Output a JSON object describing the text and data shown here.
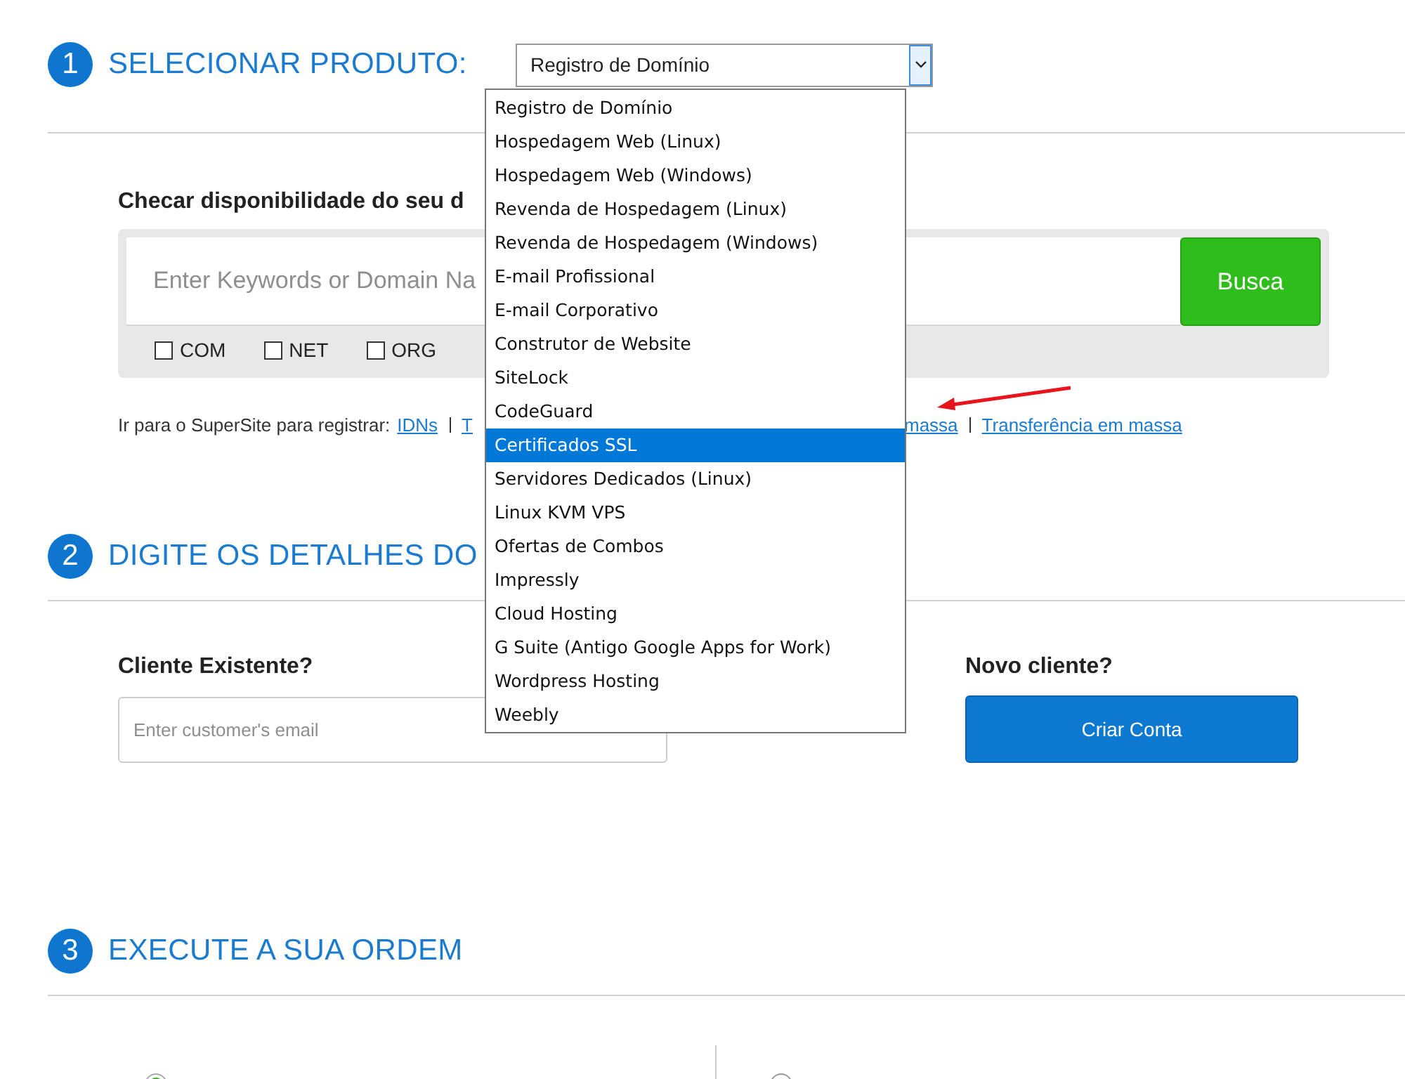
{
  "step1": {
    "number": "1",
    "title": "SELECIONAR PRODUTO:",
    "select_value": "Registro de Domínio",
    "dropdown": [
      {
        "label": "Registro de Domínio",
        "selected": false
      },
      {
        "label": "Hospedagem Web (Linux)",
        "selected": false
      },
      {
        "label": "Hospedagem Web (Windows)",
        "selected": false
      },
      {
        "label": "Revenda de Hospedagem (Linux)",
        "selected": false
      },
      {
        "label": "Revenda de Hospedagem (Windows)",
        "selected": false
      },
      {
        "label": "E-mail Profissional",
        "selected": false
      },
      {
        "label": "E-mail Corporativo",
        "selected": false
      },
      {
        "label": "Construtor de Website",
        "selected": false
      },
      {
        "label": "SiteLock",
        "selected": false
      },
      {
        "label": "CodeGuard",
        "selected": false
      },
      {
        "label": "Certificados SSL",
        "selected": true
      },
      {
        "label": "Servidores Dedicados (Linux)",
        "selected": false
      },
      {
        "label": "Linux KVM VPS",
        "selected": false
      },
      {
        "label": "Ofertas de Combos",
        "selected": false
      },
      {
        "label": "Impressly",
        "selected": false
      },
      {
        "label": "Cloud Hosting",
        "selected": false
      },
      {
        "label": "G Suite (Antigo Google Apps for Work)",
        "selected": false
      },
      {
        "label": "Wordpress Hosting",
        "selected": false
      },
      {
        "label": "Weebly",
        "selected": false
      }
    ],
    "check_heading": "Checar disponibilidade do seu d",
    "search": {
      "placeholder": "Enter Keywords or Domain Na",
      "button": "Busca"
    },
    "tlds": [
      {
        "label": "COM",
        "checked": false
      },
      {
        "label": "NET",
        "checked": false
      },
      {
        "label": "ORG",
        "checked": false
      }
    ],
    "supersite": {
      "text": "Ir para o SuperSite para registrar:",
      "links": [
        "IDNs",
        "T",
        "massa",
        "Transferência em massa"
      ]
    }
  },
  "step2": {
    "number": "2",
    "title": "DIGITE OS DETALHES DO",
    "existing": {
      "heading": "Cliente Existente?",
      "placeholder": "Enter customer's email"
    },
    "new": {
      "heading": "Novo cliente?",
      "button": "Criar Conta"
    }
  },
  "step3": {
    "number": "3",
    "title": "EXECUTE A SUA ORDEM",
    "options": [
      {
        "selected": true
      },
      {
        "selected": false
      }
    ]
  }
}
